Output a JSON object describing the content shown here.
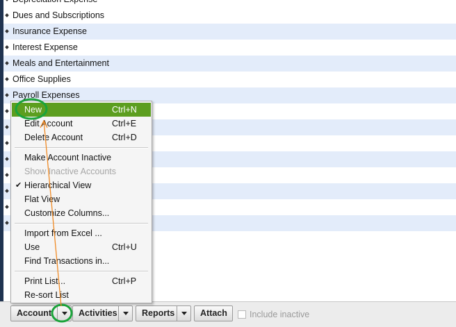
{
  "accounts": [
    "Depreciation Expense",
    "Dues and Subscriptions",
    "Insurance Expense",
    "Interest Expense",
    "Meals and Entertainment",
    "Office Supplies",
    "Payroll Expenses",
    "",
    "",
    "",
    "",
    "",
    "",
    "",
    ""
  ],
  "menu": {
    "new": {
      "label": "New",
      "shortcut": "Ctrl+N"
    },
    "edit": {
      "label": "Edit Account",
      "shortcut": "Ctrl+E"
    },
    "delete": {
      "label": "Delete Account",
      "shortcut": "Ctrl+D"
    },
    "make_inactive": {
      "label": "Make Account Inactive"
    },
    "show_inactive": {
      "label": "Show Inactive Accounts"
    },
    "hierarchical": {
      "label": "Hierarchical View",
      "checked": "✔"
    },
    "flat": {
      "label": "Flat View"
    },
    "customize": {
      "label": "Customize Columns..."
    },
    "import_excel": {
      "label": "Import from Excel ..."
    },
    "use": {
      "label": "Use",
      "shortcut": "Ctrl+U"
    },
    "find": {
      "label": "Find Transactions in..."
    },
    "print": {
      "label": "Print List...",
      "shortcut": "Ctrl+P"
    },
    "resort": {
      "label": "Re-sort List"
    }
  },
  "toolbar": {
    "account": "Account",
    "activities": "Activities",
    "reports": "Reports",
    "attach": "Attach",
    "include_inactive": "Include inactive"
  },
  "colors": {
    "highlight": "#5c9e1f",
    "annotation_circle": "#1aa33a",
    "annotation_arrow": "#f08a24",
    "row_alt": "#e3ecfa"
  }
}
